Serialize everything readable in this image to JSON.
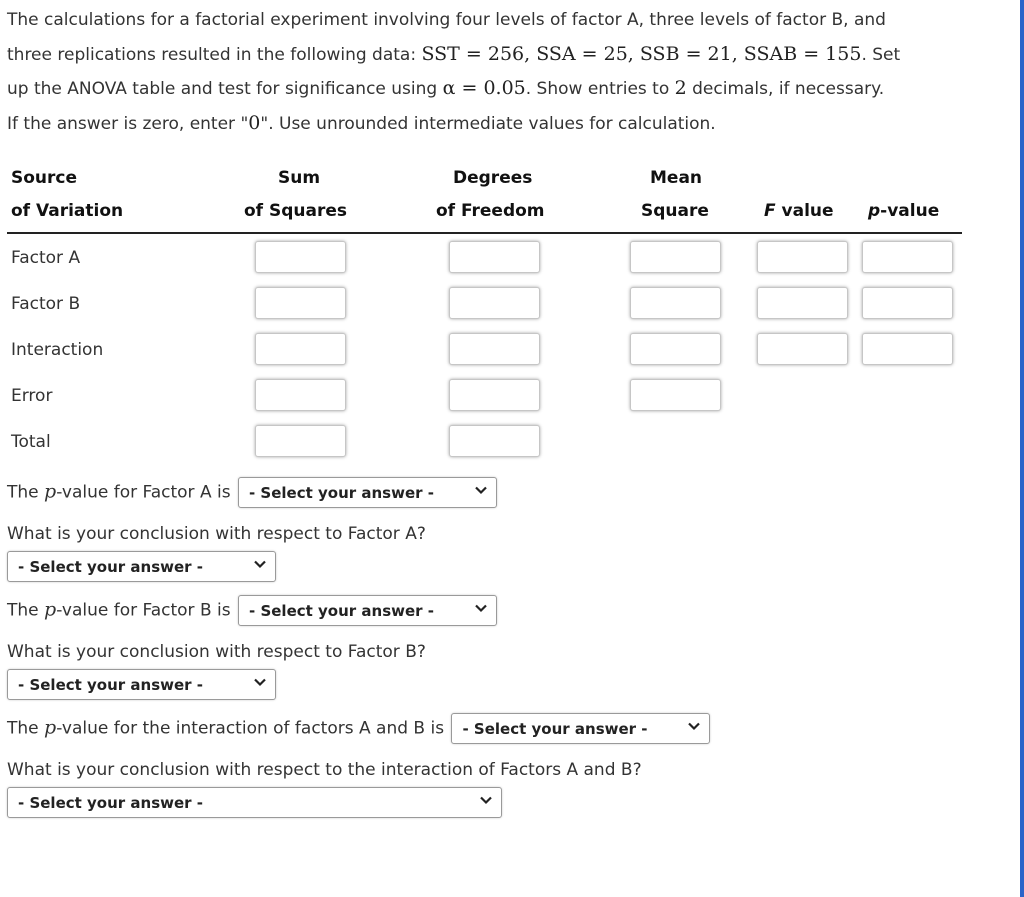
{
  "intro": {
    "line1": "The calculations for a factorial experiment involving four levels of factor A, three levels of factor B, and",
    "line2_text": "three replications resulted in the following data: ",
    "line2_math": "SST = 256, SSA = 25, SSB = 21, SSAB = 155",
    "line2_end": ". Set",
    "line3_text": "up the ANOVA table and test for significance using ",
    "line3_math": "α = 0.05",
    "line3_mid": ". Show entries to ",
    "line3_math2": "2",
    "line3_end": " decimals, if necessary.",
    "line4_text": "If the answer is zero, enter \"",
    "line4_math": "0",
    "line4_end": "\". Use unrounded intermediate values for calculation."
  },
  "table": {
    "headers": {
      "source_1": "Source",
      "source_2": "of Variation",
      "ss_1": "Sum",
      "ss_2": "of Squares",
      "df_1": "Degrees",
      "df_2": "of Freedom",
      "ms_1": "Mean",
      "ms_2": "Square",
      "f_italic": "F",
      "f_rest": " value",
      "p_italic": "p",
      "p_rest": "-value"
    },
    "rows": [
      {
        "label": "Factor A",
        "ss": "",
        "df": "",
        "ms": "",
        "f": "",
        "p": ""
      },
      {
        "label": "Factor B",
        "ss": "",
        "df": "",
        "ms": "",
        "f": "",
        "p": ""
      },
      {
        "label": "Interaction",
        "ss": "",
        "df": "",
        "ms": "",
        "f": "",
        "p": ""
      },
      {
        "label": "Error",
        "ss": "",
        "df": "",
        "ms": ""
      },
      {
        "label": "Total",
        "ss": "",
        "df": ""
      }
    ]
  },
  "questions": {
    "pA_prefix": "The ",
    "pA_var": "p",
    "pA_suffix": "-value for Factor A is",
    "concA": "What is your conclusion with respect to Factor A?",
    "pB_prefix": "The ",
    "pB_var": "p",
    "pB_suffix": "-value for Factor B is",
    "concB": "What is your conclusion with respect to Factor B?",
    "pAB_prefix": "The ",
    "pAB_var": "p",
    "pAB_suffix": "-value for the interaction of factors A and B is",
    "concAB": "What is your conclusion with respect to the interaction of Factors A and B?",
    "select_placeholder": "- Select your answer -"
  }
}
